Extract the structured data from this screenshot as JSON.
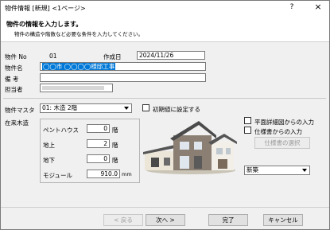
{
  "window": {
    "title": "物件情報 [新規] <1ページ>",
    "help_label": "?",
    "close_label": "×"
  },
  "header": {
    "title": "物件の情報を入力します。",
    "subtitle": "物件の構造や階数など必要な条件を入力してください。"
  },
  "form": {
    "property_no": {
      "label": "物件 No",
      "value": "01"
    },
    "created_date": {
      "label": "作成日",
      "value": "2024/11/26"
    },
    "property_name": {
      "label": "物件名",
      "value": "◯◯市 ◯◯◯◯様邸工事"
    },
    "remarks": {
      "label": "備 考",
      "value": ""
    },
    "person_in_charge": {
      "label": "担当者",
      "value": ""
    }
  },
  "structure": {
    "master_label": "物件マスタ",
    "master_value": "01: 木造 2階",
    "initial_checkbox_label": "初期値に設定する",
    "group_label": "在来木造",
    "penthouse": {
      "label": "ペントハウス",
      "value": "0",
      "unit": "階"
    },
    "above_ground": {
      "label": "地上",
      "value": "2",
      "unit": "階"
    },
    "below_ground": {
      "label": "地下",
      "value": "0",
      "unit": "階"
    },
    "module": {
      "label": "モジュール",
      "value": "910.0",
      "unit": "mm"
    }
  },
  "options": {
    "from_plan_label": "平面詳細図からの入力",
    "from_spec_label": "仕様書からの入力",
    "spec_select_button": "仕様書の選択",
    "type_value": "新築"
  },
  "footer": {
    "back": "< 戻る",
    "next": "次へ >",
    "finish": "完了",
    "cancel": "キャンセル"
  },
  "colors": {
    "selection": "#0078d7",
    "window_bg": "#f0f0f0",
    "button_bg": "#e1e1e1"
  }
}
